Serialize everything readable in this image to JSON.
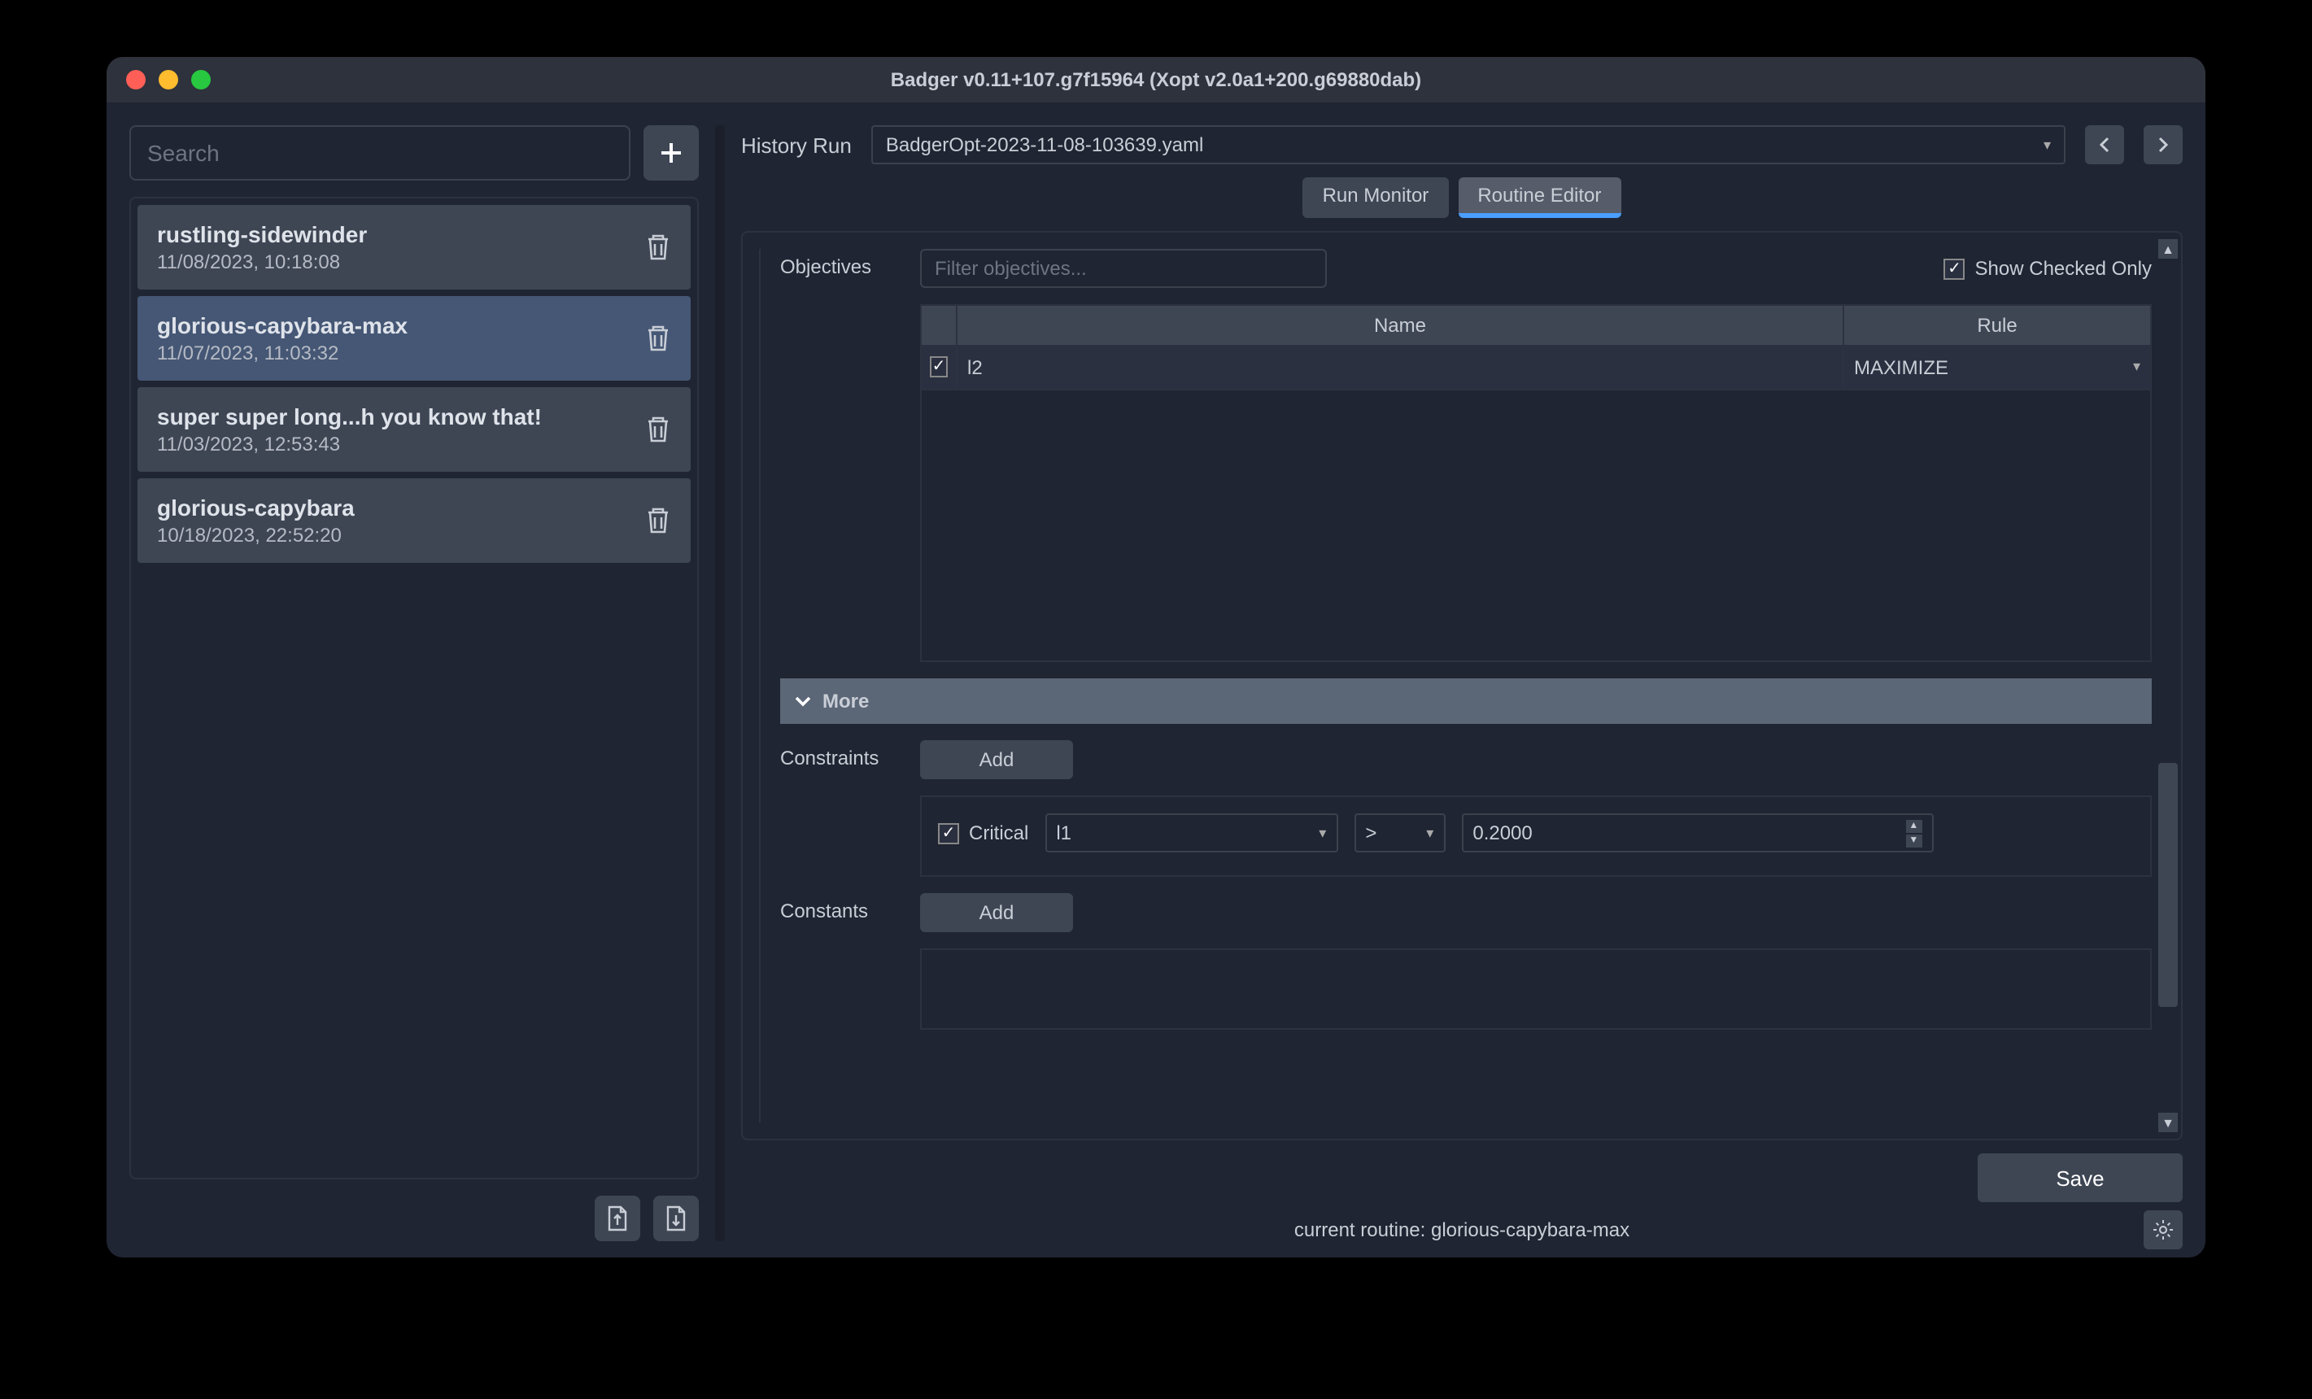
{
  "window": {
    "title": "Badger v0.11+107.g7f15964 (Xopt v2.0a1+200.g69880dab)"
  },
  "sidebar": {
    "search_placeholder": "Search",
    "routines": [
      {
        "name": "rustling-sidewinder",
        "date": "11/08/2023, 10:18:08",
        "selected": false
      },
      {
        "name": "glorious-capybara-max",
        "date": "11/07/2023, 11:03:32",
        "selected": true
      },
      {
        "name": "super super long...h you know that!",
        "date": "11/03/2023, 12:53:43",
        "selected": false
      },
      {
        "name": "glorious-capybara",
        "date": "10/18/2023, 22:52:20",
        "selected": false
      }
    ]
  },
  "main": {
    "history_run_label": "History Run",
    "history_run_value": "BadgerOpt-2023-11-08-103639.yaml",
    "tabs": {
      "run_monitor": "Run Monitor",
      "routine_editor": "Routine Editor"
    },
    "objectives": {
      "label": "Objectives",
      "filter_placeholder": "Filter objectives...",
      "show_checked_label": "Show Checked Only",
      "columns": {
        "name": "Name",
        "rule": "Rule"
      },
      "rows": [
        {
          "checked": true,
          "name": "l2",
          "rule": "MAXIMIZE"
        }
      ]
    },
    "more_label": "More",
    "constraints": {
      "label": "Constraints",
      "add_label": "Add",
      "rows": [
        {
          "critical": true,
          "critical_label": "Critical",
          "var": "l1",
          "op": ">",
          "value": "0.2000"
        }
      ]
    },
    "constants": {
      "label": "Constants",
      "add_label": "Add"
    },
    "save_label": "Save",
    "current_routine": "current routine: glorious-capybara-max"
  }
}
